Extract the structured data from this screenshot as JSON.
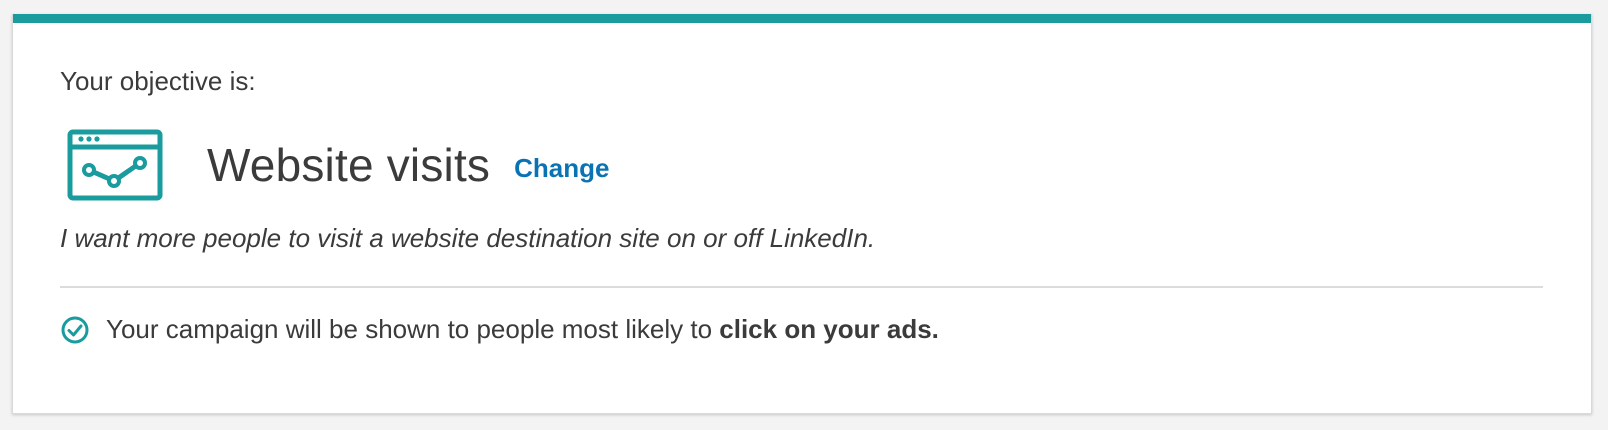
{
  "objective": {
    "label": "Your objective is:",
    "icon": "website-visits-icon",
    "title": "Website visits",
    "change_label": "Change",
    "description": "I want more people to visit a website destination site on or off LinkedIn."
  },
  "note": {
    "icon": "check-circle-icon",
    "text": "Your campaign will be shown to people most likely to ",
    "strong": "click on your ads."
  },
  "colors": {
    "accent": "#1a9b9e",
    "link": "#0a73b3",
    "text": "#3b3b3b",
    "divider": "#dcdcdc"
  }
}
